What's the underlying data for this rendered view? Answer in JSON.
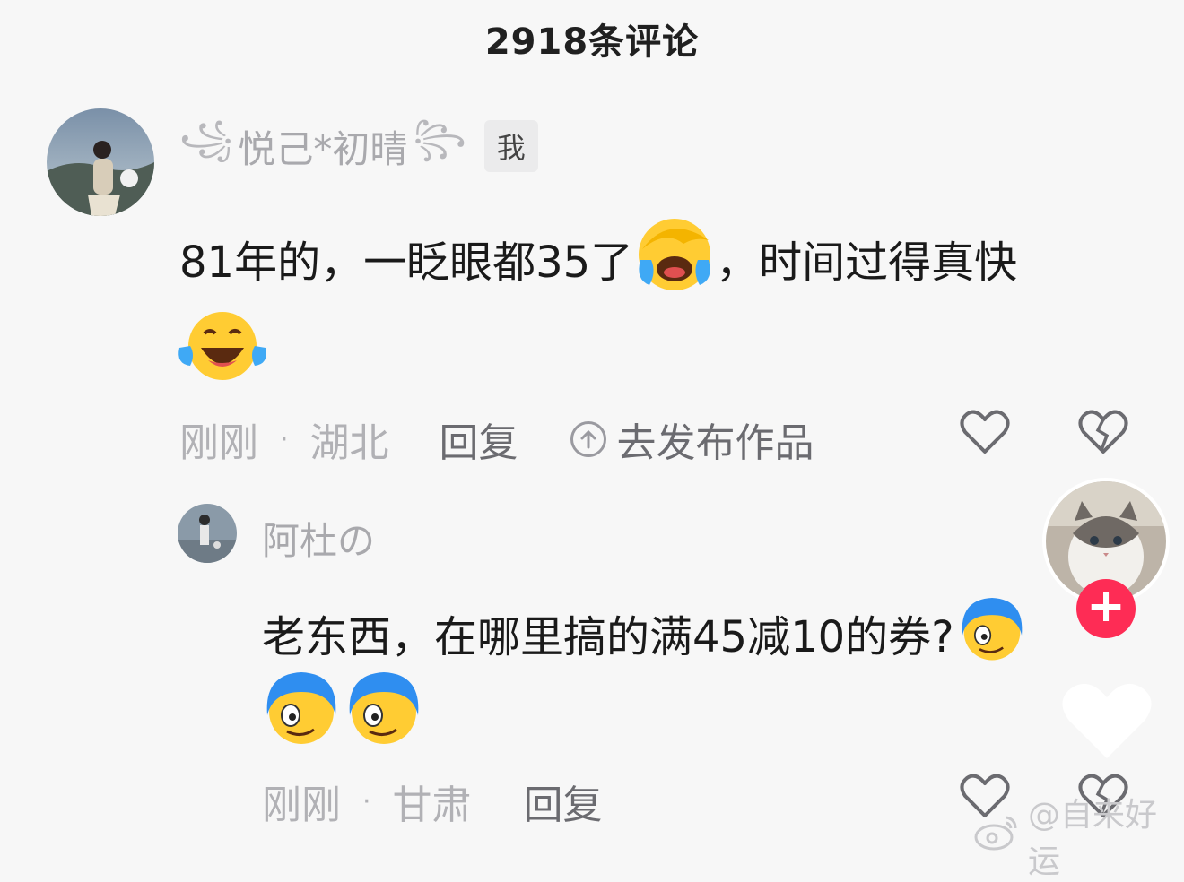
{
  "header": {
    "title": "2918条评论"
  },
  "comment1": {
    "author": "悦己*初晴",
    "author_deco_left": "꧁",
    "author_deco_right": "꧂",
    "me_tag": "我",
    "text_before": "81年的，一眨眼都35了",
    "text_after": "，时间过得真快",
    "meta": {
      "time": "刚刚",
      "separator": "·",
      "location": "湖北",
      "reply": "回复",
      "publish": "去发布作品"
    }
  },
  "comment2": {
    "author": "阿杜の",
    "text": "老东西，在哪里搞的满45减10的券?",
    "meta": {
      "time": "刚刚",
      "separator": "·",
      "location": "甘肃",
      "reply": "回复"
    }
  },
  "side": {
    "follow_plus": "+"
  },
  "watermark": {
    "text": "@自来好运"
  },
  "colors": {
    "accent": "#fe2c55",
    "muted": "#b1b1b5",
    "text": "#1a1a1a",
    "background": "#f7f7f7"
  },
  "icons": [
    "upload-icon",
    "like-icon",
    "dislike-icon",
    "weibo-icon"
  ]
}
